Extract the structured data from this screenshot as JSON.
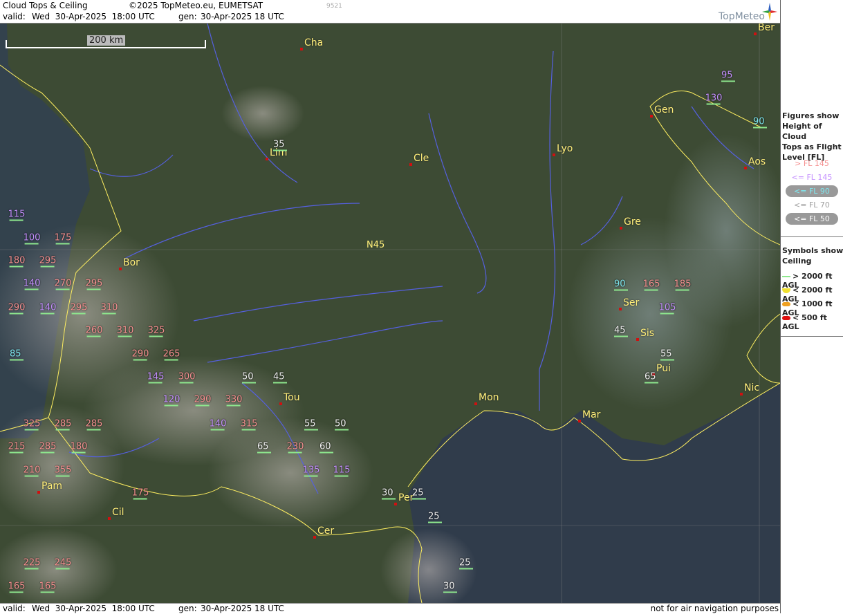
{
  "header": {
    "title": "Cloud Tops & Ceiling",
    "copyright": "©2025 TopMeteo.eu, EUMETSAT",
    "station_code": "9521",
    "valid_label": "valid:",
    "valid_time": "Wed  30-Apr-2025  18:00 UTC",
    "gen_label": "gen:",
    "gen_time": "30-Apr-2025 18 UTC",
    "logo_text": "TopMeteo"
  },
  "map": {
    "scale_label": "200 km",
    "latitude_label": "N45",
    "cities": [
      {
        "name": "Cha"
      },
      {
        "name": "Lim"
      },
      {
        "name": "Cle"
      },
      {
        "name": "Lyo"
      },
      {
        "name": "Gen"
      },
      {
        "name": "Ber"
      },
      {
        "name": "Aos"
      },
      {
        "name": "Gre"
      },
      {
        "name": "Bor"
      },
      {
        "name": "Ser"
      },
      {
        "name": "Sis"
      },
      {
        "name": "Pui"
      },
      {
        "name": "Tou"
      },
      {
        "name": "Mon"
      },
      {
        "name": "Mar"
      },
      {
        "name": "Nic"
      },
      {
        "name": "Pam"
      },
      {
        "name": "Cil"
      },
      {
        "name": "Per"
      },
      {
        "name": "Cer"
      }
    ],
    "flight_levels": [
      {
        "v": "35",
        "c": "white"
      },
      {
        "v": "95",
        "c": "violet"
      },
      {
        "v": "130",
        "c": "violet"
      },
      {
        "v": "90",
        "c": "cyan"
      },
      {
        "v": "115",
        "c": "violet"
      },
      {
        "v": "100",
        "c": "violet"
      },
      {
        "v": "175",
        "c": "salmon"
      },
      {
        "v": "180",
        "c": "salmon"
      },
      {
        "v": "295",
        "c": "salmon"
      },
      {
        "v": "140",
        "c": "violet"
      },
      {
        "v": "270",
        "c": "salmon"
      },
      {
        "v": "295",
        "c": "salmon"
      },
      {
        "v": "290",
        "c": "salmon"
      },
      {
        "v": "140",
        "c": "violet"
      },
      {
        "v": "295",
        "c": "salmon"
      },
      {
        "v": "310",
        "c": "salmon"
      },
      {
        "v": "260",
        "c": "salmon"
      },
      {
        "v": "310",
        "c": "salmon"
      },
      {
        "v": "325",
        "c": "salmon"
      },
      {
        "v": "85",
        "c": "cyan"
      },
      {
        "v": "290",
        "c": "salmon"
      },
      {
        "v": "265",
        "c": "salmon"
      },
      {
        "v": "145",
        "c": "violet"
      },
      {
        "v": "300",
        "c": "salmon"
      },
      {
        "v": "50",
        "c": "white"
      },
      {
        "v": "45",
        "c": "white"
      },
      {
        "v": "120",
        "c": "violet"
      },
      {
        "v": "290",
        "c": "salmon"
      },
      {
        "v": "330",
        "c": "salmon"
      },
      {
        "v": "325",
        "c": "salmon"
      },
      {
        "v": "285",
        "c": "salmon"
      },
      {
        "v": "285",
        "c": "salmon"
      },
      {
        "v": "140",
        "c": "violet"
      },
      {
        "v": "315",
        "c": "salmon"
      },
      {
        "v": "55",
        "c": "white"
      },
      {
        "v": "50",
        "c": "white"
      },
      {
        "v": "215",
        "c": "salmon"
      },
      {
        "v": "285",
        "c": "salmon"
      },
      {
        "v": "180",
        "c": "salmon"
      },
      {
        "v": "65",
        "c": "white"
      },
      {
        "v": "230",
        "c": "salmon"
      },
      {
        "v": "60",
        "c": "white"
      },
      {
        "v": "210",
        "c": "salmon"
      },
      {
        "v": "355",
        "c": "salmon"
      },
      {
        "v": "135",
        "c": "violet"
      },
      {
        "v": "115",
        "c": "violet"
      },
      {
        "v": "175",
        "c": "salmon"
      },
      {
        "v": "30",
        "c": "white"
      },
      {
        "v": "25",
        "c": "white"
      },
      {
        "v": "25",
        "c": "white"
      },
      {
        "v": "25",
        "c": "white"
      },
      {
        "v": "225",
        "c": "salmon"
      },
      {
        "v": "245",
        "c": "salmon"
      },
      {
        "v": "165",
        "c": "salmon"
      },
      {
        "v": "165",
        "c": "salmon"
      },
      {
        "v": "30",
        "c": "white"
      },
      {
        "v": "90",
        "c": "cyan"
      },
      {
        "v": "165",
        "c": "salmon"
      },
      {
        "v": "185",
        "c": "salmon"
      },
      {
        "v": "105",
        "c": "violet"
      },
      {
        "v": "45",
        "c": "white"
      },
      {
        "v": "55",
        "c": "white"
      },
      {
        "v": "65",
        "c": "white"
      }
    ]
  },
  "legend": {
    "figures_title": "Figures show Height of Cloud Tops as Flight Level  [FL]",
    "figures_title_lines": [
      "Figures show",
      "Height of Cloud",
      "Tops as Flight",
      "Level  [FL]"
    ],
    "fl_items": [
      "> FL 145",
      "<= FL 145",
      "<= FL 90",
      "<= FL 70",
      "<= FL 50"
    ],
    "symbols_title_lines": [
      "Symbols show",
      "Ceiling"
    ],
    "symbol_items": [
      "> 2000 ft AGL",
      "< 2000 ft AGL",
      "< 1000 ft AGL",
      "< 500 ft AGL"
    ],
    "colors": {
      "above_145": "#f59090",
      "le_145": "#c590ff",
      "le_90": "#7fe8f0",
      "le_70": "#a0a0a0",
      "le_50": "#ffffff",
      "ceiling_above_2000": "#8ee88e",
      "ceiling_below_2000": "#f0e030",
      "ceiling_below_1000": "#f0a020",
      "ceiling_below_500": "#e01010"
    }
  },
  "footer": {
    "valid_label": "valid:",
    "valid_time": "Wed  30-Apr-2025  18:00 UTC",
    "gen_label": "gen:",
    "gen_time": "30-Apr-2025 18 UTC",
    "disclaimer": "not for air navigation purposes"
  }
}
